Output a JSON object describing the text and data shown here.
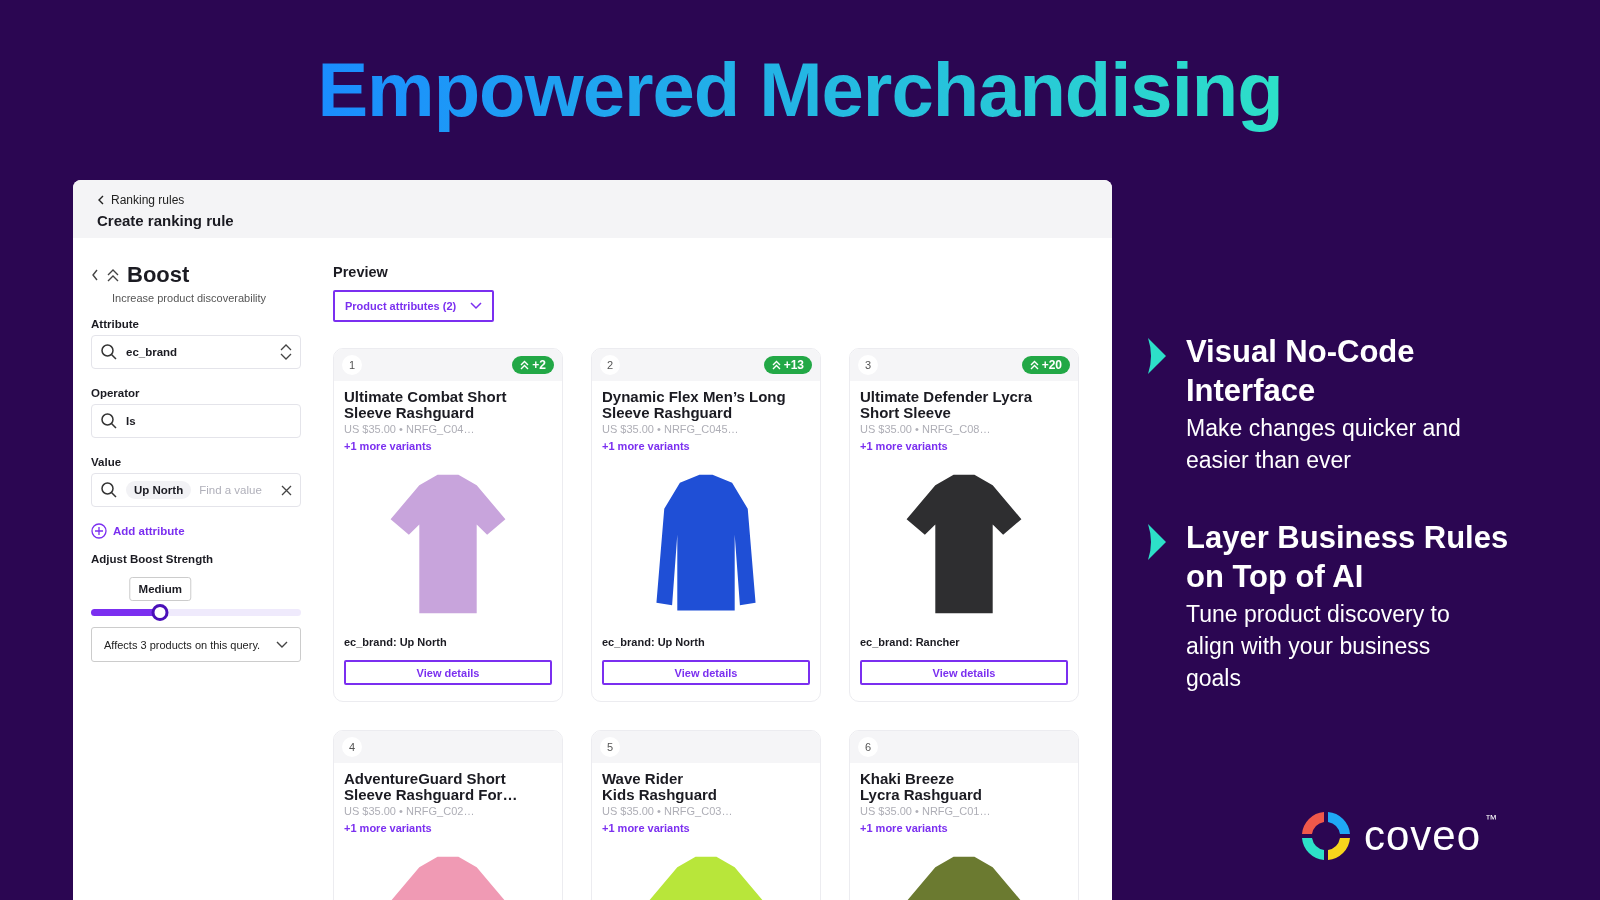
{
  "headline": "Empowered Merchandising",
  "panel": {
    "breadcrumb": "Ranking rules",
    "title": "Create ranking rule"
  },
  "rule": {
    "title": "Boost",
    "subtitle": "Increase product discoverability",
    "fields": [
      {
        "label": "Attribute",
        "kind": "select",
        "value": "ec_brand"
      },
      {
        "label": "Operator",
        "kind": "search",
        "value": "Is"
      },
      {
        "label": "Value",
        "kind": "tags",
        "tag": "Up North",
        "placeholder": "Find a value"
      }
    ],
    "add_link": "Add attribute",
    "strength_label": "Adjust Boost Strength",
    "strength": {
      "reading": "Medium",
      "level": 0.33
    },
    "affects": "Affects 3 products on this query."
  },
  "preview": {
    "title": "Preview",
    "filter": "Product attributes (2)",
    "products": [
      {
        "rank": "1",
        "boost": "+2",
        "title": "Ultimate Combat Short Sleeve Rashguard",
        "meta": "US $35.00 • NRFG_C04…",
        "variants": "+1 more variants",
        "kind": "short-sleeve",
        "color": "#c8a4dc",
        "brand": "ec_brand: Up North",
        "button": "View details"
      },
      {
        "rank": "2",
        "boost": "+13",
        "title": "Dynamic Flex Men’s Long Sleeve Rashguard",
        "meta": "US $35.00 • NRFG_C045…",
        "variants": "+1 more variants",
        "kind": "long-sleeve",
        "color": "#1f4fd6",
        "brand": "ec_brand: Up North",
        "button": "View details"
      },
      {
        "rank": "3",
        "boost": "+20",
        "title": "Ultimate Defender Lycra Short Sleeve",
        "meta": "US $35.00 • NRFG_C08…",
        "variants": "+1 more variants",
        "kind": "short-sleeve",
        "color": "#2e2e30",
        "brand": "ec_brand: Rancher",
        "button": "View details"
      },
      {
        "rank": "4",
        "title": "AdventureGuard Short Sleeve Rashguard For…",
        "meta": "US $35.00 • NRFG_C02…",
        "variants": "+1 more variants",
        "kind": "short-sleeve",
        "color": "#f09ab4"
      },
      {
        "rank": "5",
        "title": "Wave Rider\nKids Rashguard",
        "meta": "US $35.00 • NRFG_C03…",
        "variants": "+1 more variants",
        "kind": "short-sleeve",
        "color": "#b8e63a"
      },
      {
        "rank": "6",
        "title": "Khaki Breeze\nLycra Rashguard",
        "meta": "US $35.00 • NRFG_C01…",
        "variants": "+1 more variants",
        "kind": "short-sleeve",
        "color": "#6b7a30"
      }
    ]
  },
  "features": [
    {
      "title": "Visual No-Code Interface",
      "text": "Make changes quicker and easier than ever"
    },
    {
      "title": "Layer Business Rules on Top of AI",
      "text": "Tune product discovery to align with your business goals"
    }
  ],
  "logo": {
    "name": "coveo",
    "mark": "™"
  }
}
